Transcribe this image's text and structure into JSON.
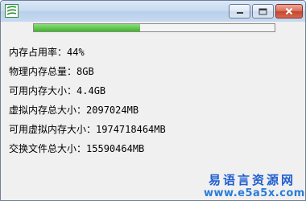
{
  "window": {
    "title": ""
  },
  "memory": {
    "usage_label": "内存占用率：",
    "usage_value": "44%",
    "usage_fraction": 0.44,
    "physical_label": "物理内存总量：",
    "physical_value": "8GB",
    "available_label": "可用内存大小：",
    "available_value": "4.4GB",
    "virtual_total_label": "虚拟内存总大小：",
    "virtual_total_value": "2097024MB",
    "virtual_avail_label": "可用虚拟内存大小：",
    "virtual_avail_value": "1974718464MB",
    "swap_label": "交换文件总大小：",
    "swap_value": "15590464MB"
  },
  "watermark": {
    "name": "易语言资源网",
    "url": "www.e5a5x.com"
  },
  "colors": {
    "progress_fill": "#3fb62a",
    "watermark": "#1f5ecf",
    "close_button": "#c8442b"
  }
}
